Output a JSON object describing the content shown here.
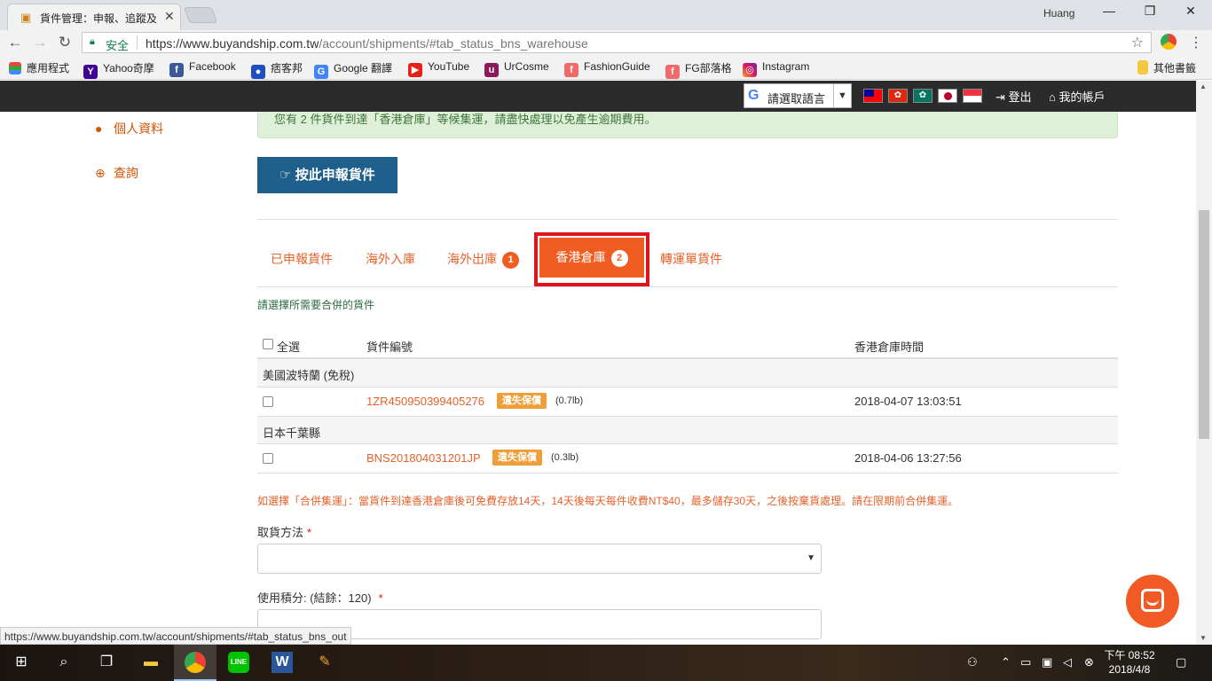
{
  "browser": {
    "tab_title": "貨件管理：申報、追蹤及",
    "profile": "Huang",
    "secure_label": "安全",
    "url_main": "https://www.buyandship.com.tw",
    "url_rest": "/account/shipments/#tab_status_bns_warehouse",
    "bookmarks": [
      "應用程式",
      "Yahoo奇摩",
      "Facebook",
      "痞客邦",
      "Google 翻譯",
      "YouTube",
      "UrCosme",
      "FashionGuide",
      "FG部落格",
      "Instagram",
      "其他書籤"
    ]
  },
  "site_header": {
    "translate_label": "請選取語言",
    "logout": "登出",
    "account": "我的帳戶"
  },
  "sidebar": {
    "items": [
      {
        "label": "個人資料",
        "icon": "user-icon"
      },
      {
        "label": "查詢",
        "icon": "lifebuoy-icon"
      }
    ]
  },
  "alert": {
    "text": "您有 2 件貨件到達「香港倉庫」等候集運，請盡快處理以免產生逾期費用。"
  },
  "declare_button": "按此申報貨件",
  "tabs": [
    {
      "label": "已申報貨件",
      "badge": ""
    },
    {
      "label": "海外入庫",
      "badge": ""
    },
    {
      "label": "海外出庫",
      "badge": "1"
    },
    {
      "label": "香港倉庫",
      "badge": "2"
    },
    {
      "label": "轉運單貨件",
      "badge": ""
    }
  ],
  "select_hint": "請選擇所需要合併的貨件",
  "table": {
    "headers": {
      "select_all": "全選",
      "tracking": "貨件編號",
      "time": "香港倉庫時間"
    },
    "groups": [
      {
        "name": "美國波特蘭 (免稅)",
        "rows": [
          {
            "tracking": "1ZR450950399405276",
            "tag": "遺失保償",
            "weight": "(0.7lb)",
            "time": "2018-04-07 13:03:51"
          }
        ]
      },
      {
        "name": "日本千葉縣",
        "rows": [
          {
            "tracking": "BNS201804031201JP",
            "tag": "遺失保償",
            "weight": "(0.3lb)",
            "time": "2018-04-06 13:27:56"
          }
        ]
      }
    ]
  },
  "notice": "如選擇「合併集運」：當貨件到達香港倉庫後可免費存放14天，14天後每天每件收費NT$40，最多儲存30天，之後按棄貨處理。請在限期前合併集運。",
  "form": {
    "pickup_label": "取貨方法",
    "points_label": "使用積分: (結餘：120)",
    "required_mark": "*"
  },
  "status_bar_url": "https://www.buyandship.com.tw/account/shipments/#tab_status_bns_out",
  "clock": {
    "time": "下午 08:52",
    "date": "2018/4/8"
  }
}
